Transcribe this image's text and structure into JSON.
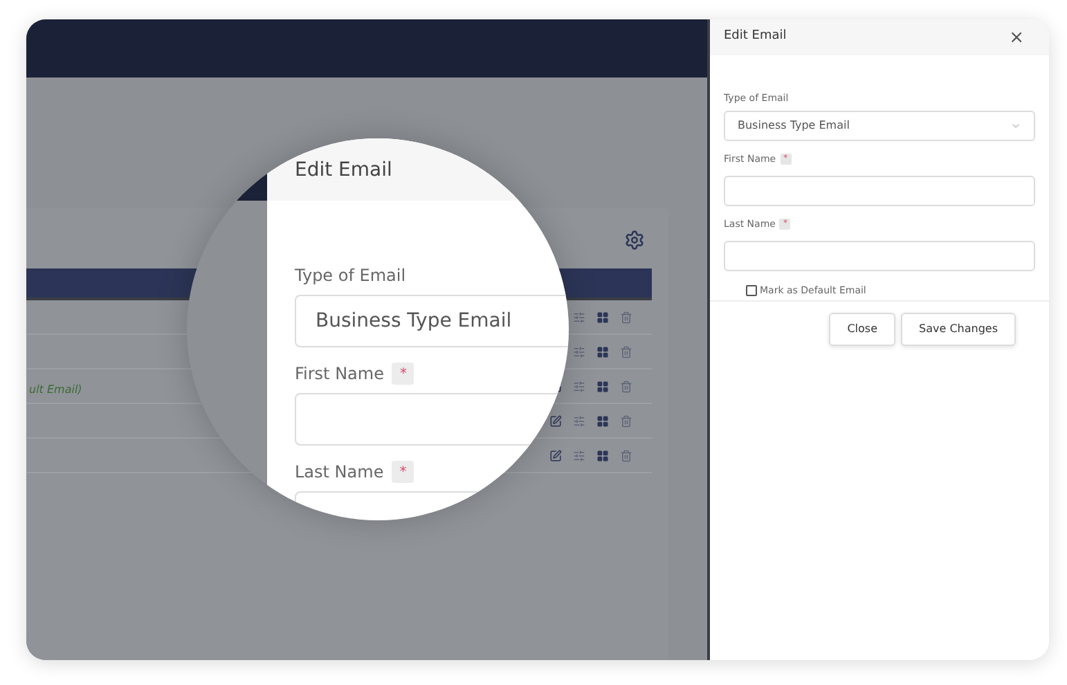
{
  "table": {
    "rows": [
      {
        "edit": false
      },
      {
        "edit": false
      },
      {
        "note": "ult Email)",
        "edit": true
      },
      {
        "edit": true
      },
      {
        "edit": true
      }
    ]
  },
  "magnifier": {
    "title": "Edit Email",
    "fields": [
      {
        "label": "Type of Email",
        "value": "Business Type Email"
      },
      {
        "label": "First Name",
        "required_mark": "*"
      },
      {
        "label": "Last Name",
        "required_mark": "*"
      }
    ]
  },
  "modal": {
    "title": "Edit Email",
    "close": "×",
    "fields": [
      {
        "label": "Type of Email",
        "kind": "select",
        "value": "Business Type Email"
      },
      {
        "label": "First Name",
        "required_mark": "*",
        "kind": "text"
      },
      {
        "label": "Last Name",
        "required_mark": "*",
        "kind": "text"
      }
    ],
    "default_checkbox": {
      "label": "Mark as Default Email",
      "checked": false
    },
    "buttons": [
      "Close",
      "Save Changes"
    ]
  }
}
